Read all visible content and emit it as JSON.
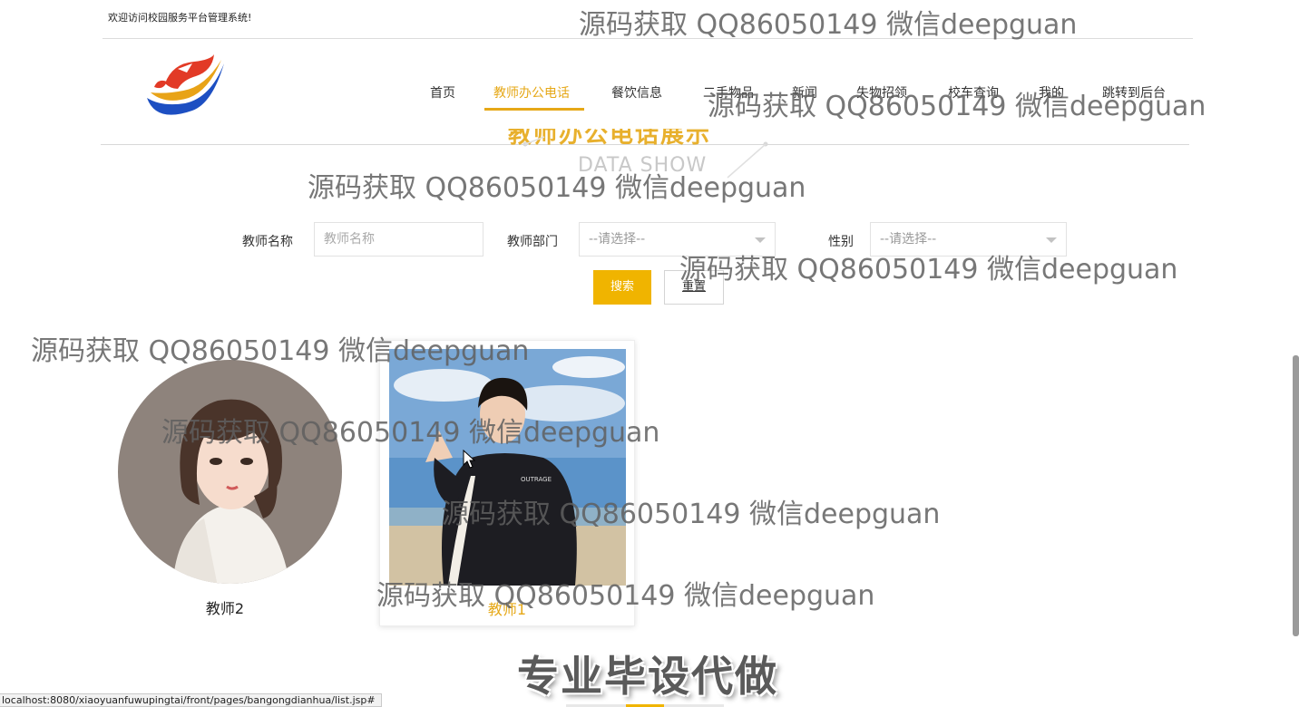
{
  "header": {
    "welcome": "欢迎访问校园服务平台管理系统!"
  },
  "nav": {
    "items": [
      "首页",
      "教师办公电话",
      "餐饮信息",
      "二手物品",
      "新闻",
      "失物招领",
      "校车查询",
      "我的",
      "跳转到后台"
    ],
    "active_index": 1
  },
  "section": {
    "title": "教师办公电话展示",
    "subtitle": "DATA SHOW"
  },
  "search": {
    "name_label": "教师名称",
    "name_placeholder": "教师名称",
    "dept_label": "教师部门",
    "dept_value": "--请选择--",
    "gender_label": "性别",
    "gender_value": "--请选择--",
    "search_button": "搜索",
    "reset_button": "重置"
  },
  "teachers": [
    {
      "name": "教师2"
    },
    {
      "name": "教师1"
    }
  ],
  "promo": {
    "text": "专业毕设代做"
  },
  "watermark": "源码获取 QQ86050149 微信deepguan",
  "status_bar": "localhost:8080/xiaoyuanfuwupingtai/front/pages/bangongdianhua/list.jsp#",
  "colors": {
    "accent": "#e6a817",
    "button": "#f0b400"
  }
}
